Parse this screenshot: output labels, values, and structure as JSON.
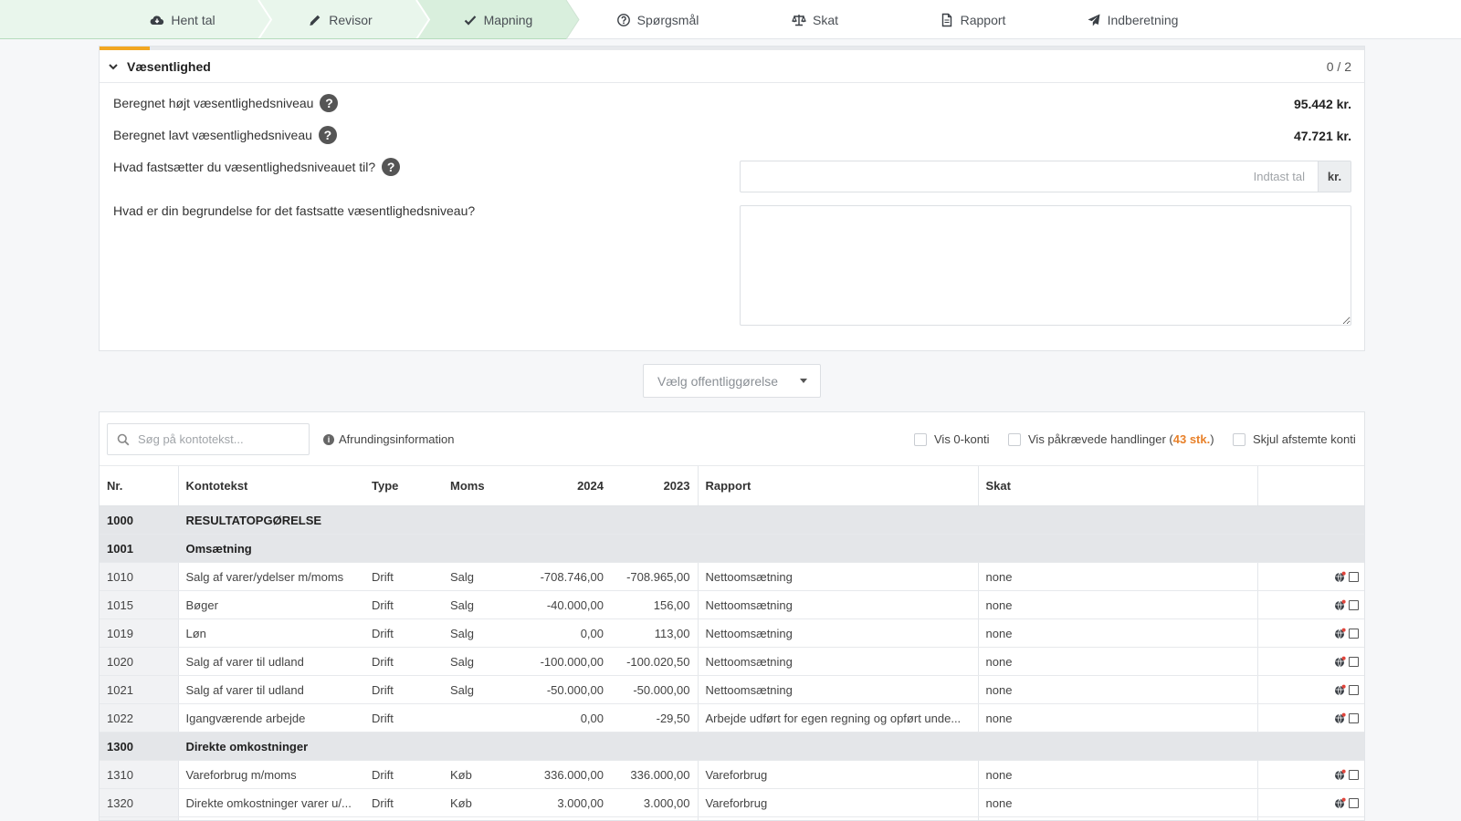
{
  "nav": {
    "steps": [
      {
        "label": "Hent tal",
        "icon": "cloud-download-icon",
        "state": "done"
      },
      {
        "label": "Revisor",
        "icon": "pencil-icon",
        "state": "done"
      },
      {
        "label": "Mapning",
        "icon": "check-icon",
        "state": "current"
      },
      {
        "label": "Spørgsmål",
        "icon": "question-circle-icon",
        "state": "todo"
      },
      {
        "label": "Skat",
        "icon": "scale-icon",
        "state": "todo"
      },
      {
        "label": "Rapport",
        "icon": "document-icon",
        "state": "todo"
      },
      {
        "label": "Indberetning",
        "icon": "send-icon",
        "state": "todo"
      }
    ]
  },
  "materiality": {
    "title": "Væsentlighed",
    "count": "0 / 2",
    "progress": 0.04,
    "high_label": "Beregnet højt væsentlighedsniveau",
    "high_value": "95.442 kr.",
    "low_label": "Beregnet lavt væsentlighedsniveau",
    "low_value": "47.721 kr.",
    "set_label": "Hvad fastsætter du væsentlighedsniveauet til?",
    "set_placeholder": "Indtast tal",
    "set_unit": "kr.",
    "reason_label": "Hvad er din begrundelse for det fastsatte væsentlighedsniveau?",
    "reason_value": ""
  },
  "publication_select": {
    "placeholder": "Vælg offentliggørelse"
  },
  "toolbar": {
    "search_placeholder": "Søg på kontotekst...",
    "rounding_info": "Afrundingsinformation",
    "show_zero": "Vis 0-konti",
    "show_required_prefix": "Vis påkrævede handlinger (",
    "show_required_count": "43 stk.",
    "show_required_suffix": ")",
    "hide_reconciled": "Skjul afstemte konti"
  },
  "colors": {
    "accent": "#f2a721",
    "count_accent": "#e8812a",
    "step_done": "#e9f6ec",
    "step_current": "#d9efdd"
  },
  "table": {
    "headers": {
      "nr": "Nr.",
      "text": "Kontotekst",
      "type": "Type",
      "vat": "Moms",
      "y2024": "2024",
      "y2023": "2023",
      "report": "Rapport",
      "tax": "Skat"
    },
    "rows": [
      {
        "kind": "group",
        "nr": "1000",
        "text": "RESULTATOPGØRELSE"
      },
      {
        "kind": "group",
        "nr": "1001",
        "text": "Omsætning"
      },
      {
        "kind": "account",
        "nr": "1010",
        "text": "Salg af varer/ydelser m/moms",
        "type": "Drift",
        "vat": "Salg",
        "y2024": "-708.746,00",
        "y2023": "-708.965,00",
        "report": "Nettoomsætning",
        "tax": "none"
      },
      {
        "kind": "account",
        "nr": "1015",
        "text": "Bøger",
        "type": "Drift",
        "vat": "Salg",
        "y2024": "-40.000,00",
        "y2023": "156,00",
        "report": "Nettoomsætning",
        "tax": "none"
      },
      {
        "kind": "account",
        "nr": "1019",
        "text": "Løn",
        "type": "Drift",
        "vat": "Salg",
        "y2024": "0,00",
        "y2023": "113,00",
        "report": "Nettoomsætning",
        "tax": "none"
      },
      {
        "kind": "account",
        "nr": "1020",
        "text": "Salg af varer til udland",
        "type": "Drift",
        "vat": "Salg",
        "y2024": "-100.000,00",
        "y2023": "-100.020,50",
        "report": "Nettoomsætning",
        "tax": "none"
      },
      {
        "kind": "account",
        "nr": "1021",
        "text": "Salg af varer til udland",
        "type": "Drift",
        "vat": "Salg",
        "y2024": "-50.000,00",
        "y2023": "-50.000,00",
        "report": "Nettoomsætning",
        "tax": "none"
      },
      {
        "kind": "account",
        "nr": "1022",
        "text": "Igangværende arbejde",
        "type": "Drift",
        "vat": "",
        "y2024": "0,00",
        "y2023": "-29,50",
        "report": "Arbejde udført for egen regning og opført unde...",
        "tax": "none"
      },
      {
        "kind": "group",
        "nr": "1300",
        "text": "Direkte omkostninger"
      },
      {
        "kind": "account",
        "nr": "1310",
        "text": "Vareforbrug m/moms",
        "type": "Drift",
        "vat": "Køb",
        "y2024": "336.000,00",
        "y2023": "336.000,00",
        "report": "Vareforbrug",
        "tax": "none"
      },
      {
        "kind": "account",
        "nr": "1320",
        "text": "Direkte omkostninger varer u/...",
        "type": "Drift",
        "vat": "Køb",
        "y2024": "3.000,00",
        "y2023": "3.000,00",
        "report": "Vareforbrug",
        "tax": "none"
      },
      {
        "kind": "account",
        "nr": "",
        "text": "",
        "type": "",
        "vat": "",
        "y2024": "",
        "y2023": "",
        "report": "",
        "tax": ""
      }
    ]
  }
}
